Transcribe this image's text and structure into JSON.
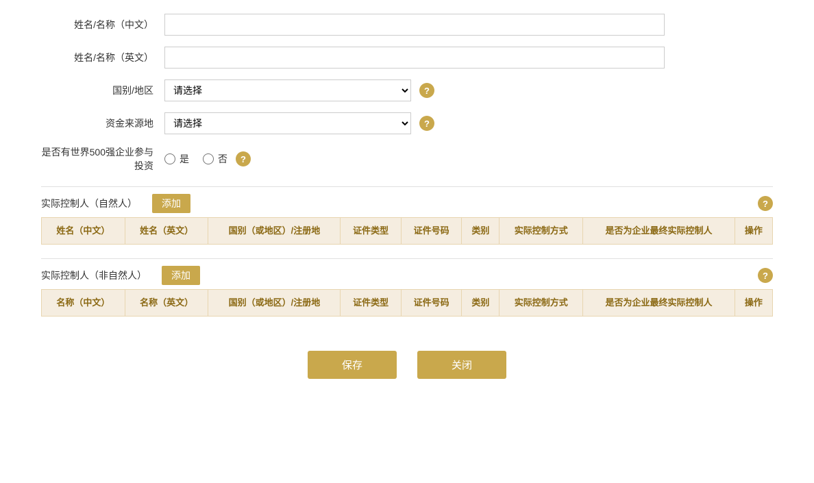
{
  "form": {
    "name_cn_label": "姓名/名称（中文）",
    "name_en_label": "姓名/名称（英文）",
    "country_label": "国别/地区",
    "fund_source_label": "资金来源地",
    "fortune500_label": "是否有世界500强企业参与投资",
    "country_placeholder": "请选择",
    "fund_source_placeholder": "请选择",
    "yes_label": "是",
    "no_label": "否"
  },
  "natural_person": {
    "title": "实际控制人（自然人）",
    "add_btn": "添加",
    "columns": [
      "姓名（中文）",
      "姓名（英文）",
      "国别（或地区）/注册地",
      "证件类型",
      "证件号码",
      "类别",
      "实际控制方式",
      "是否为企业最终实际控制人",
      "操作"
    ]
  },
  "non_natural_person": {
    "title": "实际控制人（非自然人）",
    "add_btn": "添加",
    "columns": [
      "名称（中文）",
      "名称（英文）",
      "国别（或地区）/注册地",
      "证件类型",
      "证件号码",
      "类别",
      "实际控制方式",
      "是否为企业最终实际控制人",
      "操作"
    ]
  },
  "buttons": {
    "save": "保存",
    "close": "关闭"
  },
  "help_icon": "?"
}
